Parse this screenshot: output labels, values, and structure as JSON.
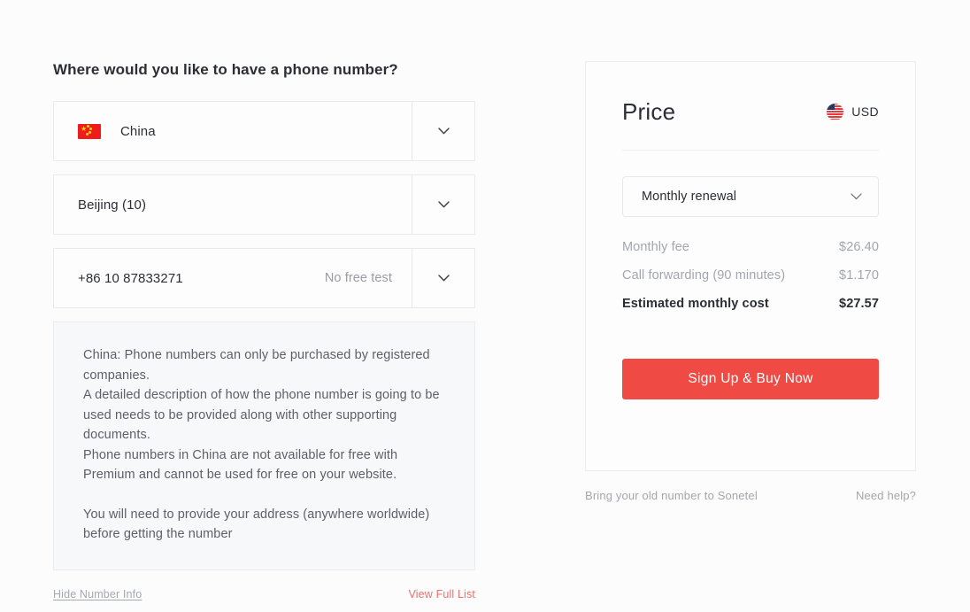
{
  "left": {
    "title": "Where would you like to have a phone number?",
    "country_select": {
      "value": "China",
      "flag": "cn-flag-icon",
      "chevron": "chevron-down-icon"
    },
    "area_select": {
      "value": "Beijing (10)",
      "chevron": "chevron-down-icon"
    },
    "number_select": {
      "value": "+86 10 87833271",
      "note": "No free test",
      "chevron": "chevron-down-icon"
    },
    "info": {
      "paragraph_1": "China: Phone numbers can only be purchased by registered companies.",
      "paragraph_2": "A detailed description of how the phone number is going to be used needs to be provided along with other supporting documents.",
      "paragraph_3": "Phone numbers in China are not available for free with Premium and cannot be used for free on your website.",
      "paragraph_4": "You will need to provide your address (anywhere worldwide) before getting the number"
    },
    "hide_info_link": "Hide Number Info",
    "view_full_list_link": "View Full List"
  },
  "right": {
    "price_title": "Price",
    "currency": {
      "code": "USD",
      "flag": "us-flag-icon"
    },
    "renewal_select": {
      "value": "Monthly renewal",
      "chevron": "chevron-down-icon"
    },
    "rows": [
      {
        "label": "Monthly fee",
        "amount": "$26.40"
      },
      {
        "label": "Call forwarding (90 minutes)",
        "amount": "$1.170"
      }
    ],
    "total": {
      "label": "Estimated monthly cost",
      "amount": "$27.57"
    },
    "buy_button": "Sign Up & Buy Now",
    "footer": {
      "port_link": "Bring your old number to Sonetel",
      "help_link": "Need help?"
    }
  },
  "colors": {
    "accent_red": "#ef4a44",
    "link_red": "#f2706c",
    "text_dark": "#2c2e35",
    "text_muted": "#a4a6ad",
    "panel_bg": "#f7f8fa"
  }
}
